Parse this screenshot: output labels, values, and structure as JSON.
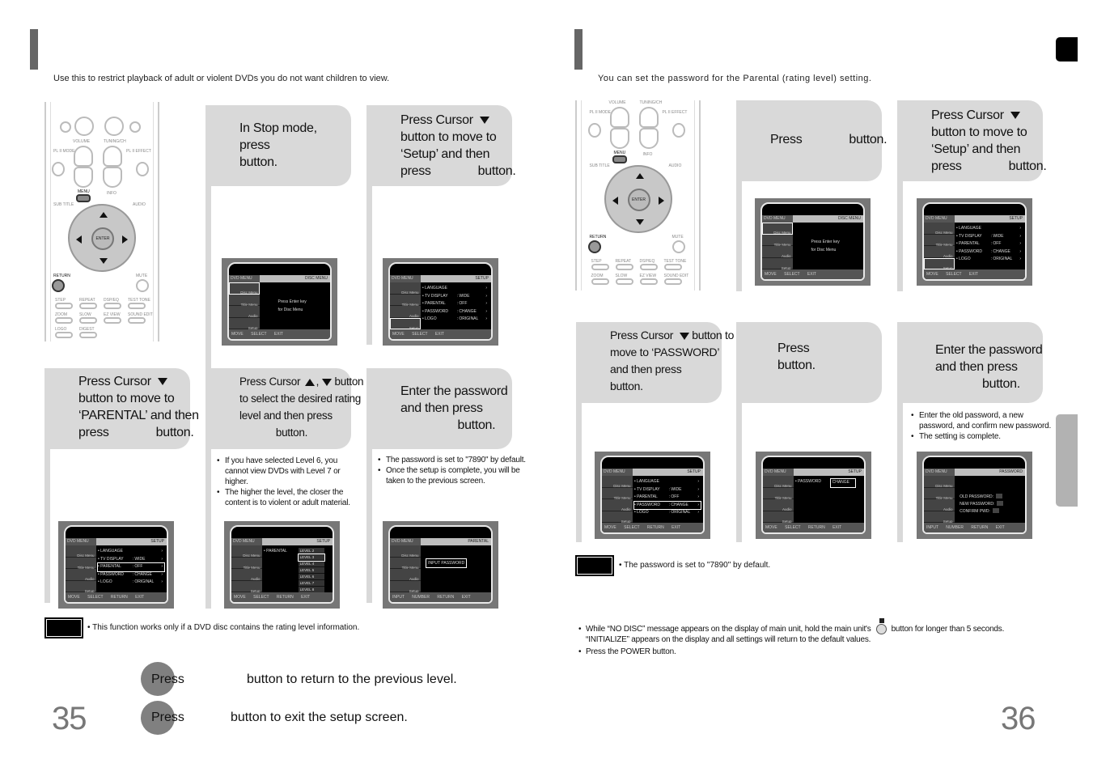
{
  "left_page": {
    "intro": "Use this to restrict playback of adult or violent DVDs you do not want children to view.",
    "steps": [
      {
        "lines": [
          "In Stop mode,",
          "press",
          "button."
        ]
      },
      {
        "lines": [
          "Press Cursor ▼",
          "button to move to",
          "‘Setup’ and then",
          "press              button."
        ]
      },
      {
        "lines": [
          "Press Cursor ▼",
          "button to move to",
          "‘PARENTAL’ and then",
          "press              button."
        ]
      },
      {
        "lines": [
          "Press Cursor ▲,▼ button",
          "to select the desired rating",
          "level and then press",
          "             button."
        ]
      },
      {
        "lines": [
          "Enter the password",
          "and then press",
          "                 button."
        ]
      }
    ],
    "step4_bullets": [
      "If you have selected Level 6, you cannot view DVDs with Level 7 or higher.",
      "The higher the level, the closer the content is to violent or adult material."
    ],
    "step5_bullets": [
      "The password is set to \"7890\" by default.",
      "Once the setup is complete, you will be taken to the previous screen."
    ],
    "note": "This function works only if a DVD disc contains the rating level information.",
    "press_lines": [
      {
        "press": "Press",
        "rest": "button to return to the previous level."
      },
      {
        "press": "Press",
        "rest": "button to exit the setup screen."
      }
    ],
    "page_number": "35"
  },
  "right_page": {
    "intro": "You can set the password for the Parental (rating level) setting.",
    "steps": [
      {
        "lines": [
          "Press              button."
        ]
      },
      {
        "lines": [
          "Press Cursor ▼",
          "button to move to",
          "‘Setup’ and then",
          "press              button."
        ]
      },
      {
        "lines": [
          "Press Cursor ▼ button to",
          "move to ‘PASSWORD’",
          "and then press",
          "button."
        ]
      },
      {
        "lines": [
          "Press",
          "button."
        ]
      },
      {
        "lines": [
          "Enter the password",
          "and then press",
          "              button."
        ]
      }
    ],
    "step5_bullets": [
      "Enter the old password, a new password, and confirm new password.",
      "The setting is complete."
    ],
    "note": "The password is set to \"7890\" by default.",
    "reset_bullets": [
      "While “NO DISC” message appears on the display of main unit, hold the main unit's",
      "button for longer than 5 seconds. “INITIALIZE” appears on the display and all settings will return to the default values.",
      "Press the POWER button."
    ],
    "page_number": "36"
  },
  "remote": {
    "labels": {
      "volume": "VOLUME",
      "tuning": "TUNING/CH",
      "mode": "PL II MODE",
      "effect": "PL II EFFECT",
      "menu": "MENU",
      "info": "INFO",
      "subtitle": "SUB TITLE",
      "audio": "AUDIO",
      "enter": "ENTER",
      "return": "RETURN",
      "mute": "MUTE",
      "step": "STEP",
      "repeat": "REPEAT",
      "dspeq": "DSP/EQ",
      "testtone": "TEST TONE",
      "zoom": "ZOOM",
      "slow": "SLOW",
      "ezview": "EZ VIEW",
      "soundedit": "SOUND EDIT",
      "logo": "LOGO",
      "digest": "DIGEST"
    }
  },
  "tv": {
    "side": [
      "Disc Menu",
      "Title Menu",
      "Audio",
      "Setup"
    ],
    "head_left": "DVD MENU",
    "disc_menu_title": "DISC MENU",
    "setup_title": "SETUP",
    "parental_title": "PARENTAL",
    "password_title": "PASSWORD",
    "press_enter": [
      "Press Enter key",
      "for Disc Menu"
    ],
    "setup_rows": [
      {
        "k": "• LANGUAGE",
        "v": "",
        "a": "›"
      },
      {
        "k": "• TV DISPLAY",
        "v": ":  WIDE",
        "a": "›"
      },
      {
        "k": "• PARENTAL",
        "v": ":  OFF",
        "a": "›"
      },
      {
        "k": "• PASSWORD",
        "v": ":  CHANGE",
        "a": "›"
      },
      {
        "k": "• LOGO",
        "v": ":  ORIGINAL",
        "a": "›"
      }
    ],
    "parental_label": "• PARENTAL",
    "levels": [
      "LEVEL 2",
      "LEVEL 3",
      "LEVEL 4",
      "LEVEL 5",
      "LEVEL 6",
      "LEVEL 7",
      "LEVEL 8"
    ],
    "input_password": "INPUT PASSWORD",
    "password_label": "• PASSWORD",
    "change": "CHANGE",
    "pw_fields": [
      "OLD PASSWORD",
      "NEW PASSWORD",
      "CONFIRM PWD"
    ],
    "foot_move_select_exit": "MOVE  SELECT            EXIT",
    "foot_move_select_return_exit": "MOVE  SELECT  RETURN  EXIT",
    "foot_input": "INPUT NUMBER         RETURN  EXIT"
  }
}
